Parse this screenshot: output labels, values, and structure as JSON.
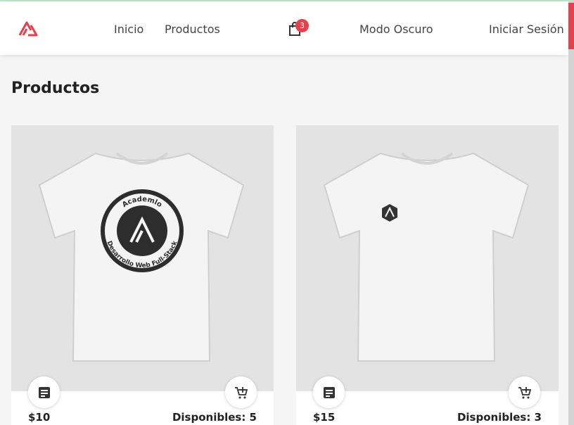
{
  "nav": {
    "links": [
      "Inicio",
      "Productos"
    ],
    "cart_count": "3",
    "dark_mode": "Modo Oscuro",
    "login": "Iniciar Sesión",
    "accent": "#e4414e"
  },
  "page": {
    "title": "Productos"
  },
  "products": [
    {
      "price": "$10",
      "stock": "Disponibles: 5",
      "print_top": "Academlo",
      "print_bottom": "Desarrollo Web Full-Stack"
    },
    {
      "price": "$15",
      "stock": "Disponibles: 3"
    }
  ]
}
